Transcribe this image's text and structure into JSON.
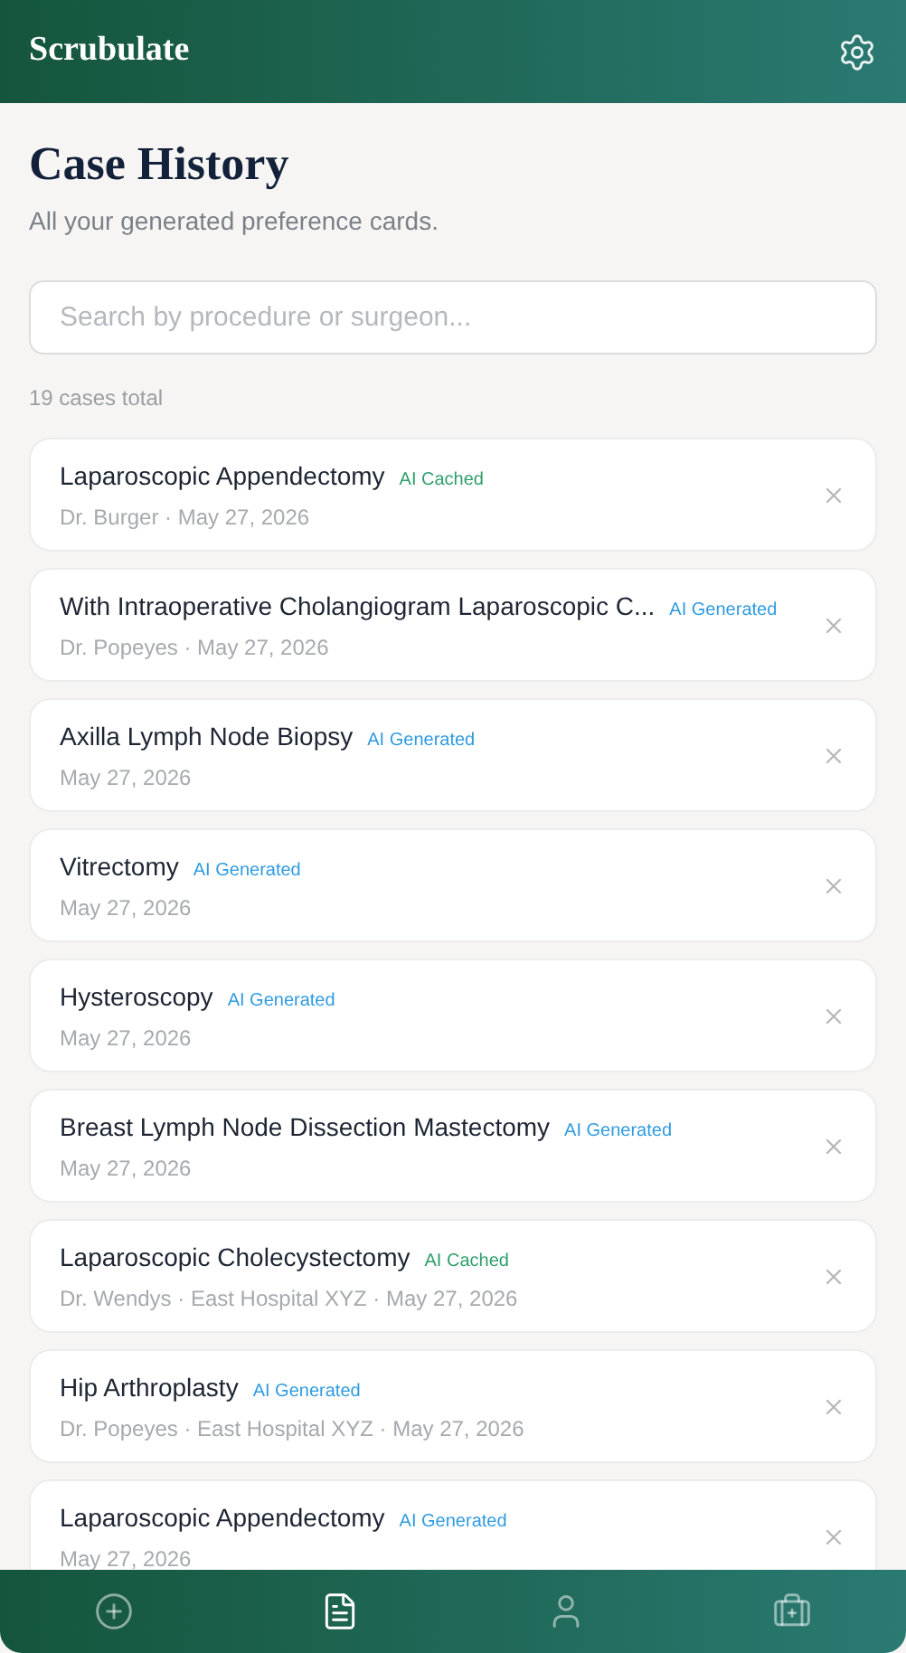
{
  "app_bar": {
    "title": "Scrubulate"
  },
  "page": {
    "title": "Case History",
    "subtitle": "All your generated preference cards."
  },
  "search": {
    "placeholder": "Search by procedure or surgeon..."
  },
  "count": "19 cases total",
  "cases": [
    {
      "title": "Laparoscopic Appendectomy",
      "badge": {
        "kind": "cached",
        "label": "AI Cached"
      },
      "details": "Dr. Burger · May 27, 2026"
    },
    {
      "title": "With Intraoperative Cholangiogram Laparoscopic C...",
      "badge": {
        "kind": "generated",
        "label": "AI Generated"
      },
      "details": "Dr. Popeyes · May 27, 2026"
    },
    {
      "title": "Axilla Lymph Node Biopsy",
      "badge": {
        "kind": "generated",
        "label": "AI Generated"
      },
      "details": "May 27, 2026"
    },
    {
      "title": "Vitrectomy",
      "badge": {
        "kind": "generated",
        "label": "AI Generated"
      },
      "details": "May 27, 2026"
    },
    {
      "title": "Hysteroscopy",
      "badge": {
        "kind": "generated",
        "label": "AI Generated"
      },
      "details": "May 27, 2026"
    },
    {
      "title": "Breast Lymph Node Dissection Mastectomy",
      "badge": {
        "kind": "generated",
        "label": "AI Generated"
      },
      "details": "May 27, 2026"
    },
    {
      "title": "Laparoscopic Cholecystectomy",
      "badge": {
        "kind": "cached",
        "label": "AI Cached"
      },
      "details": "Dr. Wendys · East Hospital XYZ · May 27, 2026"
    },
    {
      "title": "Hip Arthroplasty",
      "badge": {
        "kind": "generated",
        "label": "AI Generated"
      },
      "details": "Dr. Popeyes · East Hospital XYZ · May 27, 2026"
    },
    {
      "title": "Laparoscopic Appendectomy",
      "badge": {
        "kind": "generated",
        "label": "AI Generated"
      },
      "details": "May 27, 2026"
    }
  ],
  "nav": [
    {
      "kind": "new",
      "selected": false
    },
    {
      "kind": "history",
      "selected": true
    },
    {
      "kind": "profile",
      "selected": false
    },
    {
      "kind": "kit",
      "selected": false
    }
  ]
}
